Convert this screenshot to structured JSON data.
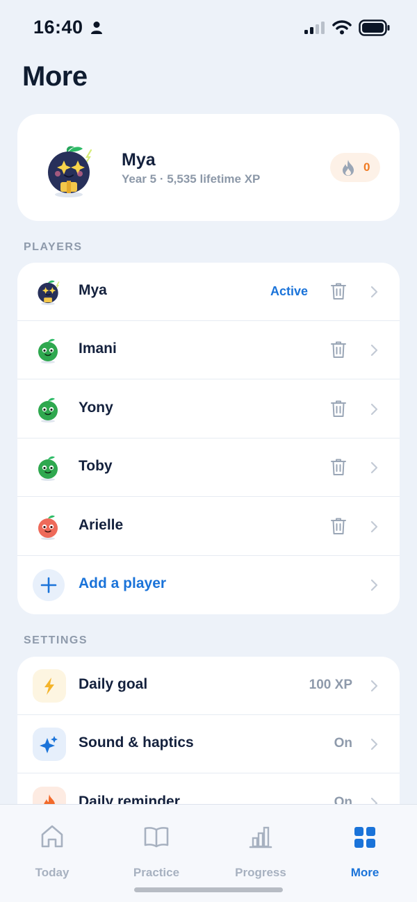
{
  "status_bar": {
    "time": "16:40"
  },
  "page": {
    "title": "More"
  },
  "profile": {
    "name": "Mya",
    "subtitle": "Year 5 · 5,535 lifetime XP",
    "streak": "0",
    "colors": {
      "streak_bg": "#fdf1e7",
      "streak_text": "#f07a22"
    }
  },
  "players_section": {
    "label": "PLAYERS",
    "players": [
      {
        "name": "Mya",
        "avatar": "navy-starry-eyed-mascot-icon",
        "status": "Active"
      },
      {
        "name": "Imani",
        "avatar": "green-mascot-icon"
      },
      {
        "name": "Yony",
        "avatar": "green-mascot-icon"
      },
      {
        "name": "Toby",
        "avatar": "green-mascot-icon"
      },
      {
        "name": "Arielle",
        "avatar": "red-mascot-icon"
      }
    ],
    "add_label": "Add a player"
  },
  "settings_section": {
    "label": "SETTINGS",
    "items": [
      {
        "label": "Daily goal",
        "value": "100 XP",
        "icon": "lightning-icon"
      },
      {
        "label": "Sound & haptics",
        "value": "On",
        "icon": "sparkle-icon"
      },
      {
        "label": "Daily reminder",
        "value": "On",
        "icon": "flame-icon"
      }
    ]
  },
  "tab_bar": {
    "tabs": [
      {
        "label": "Today",
        "icon": "home-icon"
      },
      {
        "label": "Practice",
        "icon": "book-icon"
      },
      {
        "label": "Progress",
        "icon": "bar-chart-icon"
      },
      {
        "label": "More",
        "icon": "grid-icon",
        "active": true
      }
    ]
  },
  "colors": {
    "background": "#edf2f9",
    "accent": "#1a73d9",
    "text_primary": "#14213d",
    "text_muted": "#8e9aab"
  }
}
